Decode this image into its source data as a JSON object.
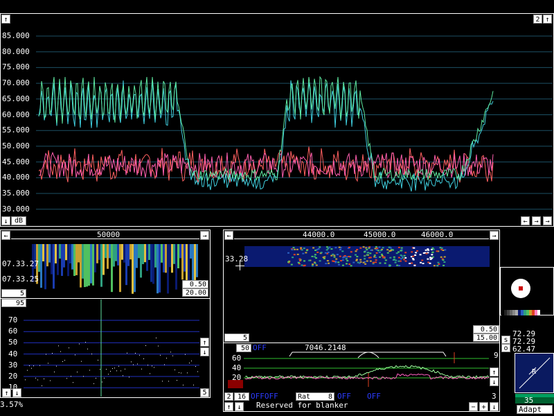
{
  "main_spectrum": {
    "y_labels": [
      "85.000",
      "80.000",
      "75.000",
      "70.000",
      "65.000",
      "60.000",
      "55.000",
      "50.000",
      "45.000",
      "40.000",
      "35.000",
      "30.000"
    ],
    "ylim": [
      28,
      90
    ],
    "zoom_value": "2",
    "unit_label": "dB",
    "up_arrow": "↑",
    "down_arrow": "↓",
    "left_arrow": "←",
    "right_arrow": "→",
    "colors": {
      "green": "#5ee8a0",
      "pink": "#ff5fb0",
      "red": "#ff6060",
      "cyan": "#40d0e0",
      "grid": "#1c5064"
    }
  },
  "left_waterfall": {
    "freq_label": "50000",
    "time_top": "07.33.27",
    "time_bottom": "07.33.25",
    "gain": "0.50",
    "range": "20.00",
    "avg_value": "5"
  },
  "left_graph": {
    "top_value": "95",
    "y_labels": [
      "70",
      "60",
      "50",
      "40",
      "30",
      "20",
      "10"
    ],
    "percent": "3.57%",
    "right_value": "5"
  },
  "right_waterfall": {
    "freq_labels": [
      "44000.0",
      "45000.0",
      "46000.0"
    ],
    "time_label": "33.28",
    "gain": "0.50",
    "range": "15.00",
    "avg_value": "5",
    "s_label": "s",
    "o_label": "o",
    "meter_values": [
      "72.29",
      "72.29",
      "62.47"
    ]
  },
  "baseband": {
    "avg_value": "50",
    "off_label": "OFF",
    "frequency": "7046.2148",
    "y_labels": [
      "60",
      "40",
      "20"
    ],
    "right_top": "9",
    "right_bottom": "3",
    "bottom_left_a": "2",
    "bottom_left_b": "16",
    "mode_label_1": "OFFOFF",
    "rat_label": "Rat",
    "rat_value": "8",
    "mode_label_2": "OFF",
    "mode_label_3": "OFF",
    "reserved_text": "Reserved for blanker",
    "minus": "−",
    "plus": "+"
  },
  "smeter": {
    "value": "35",
    "mode": "Adapt",
    "letter": "R"
  }
}
